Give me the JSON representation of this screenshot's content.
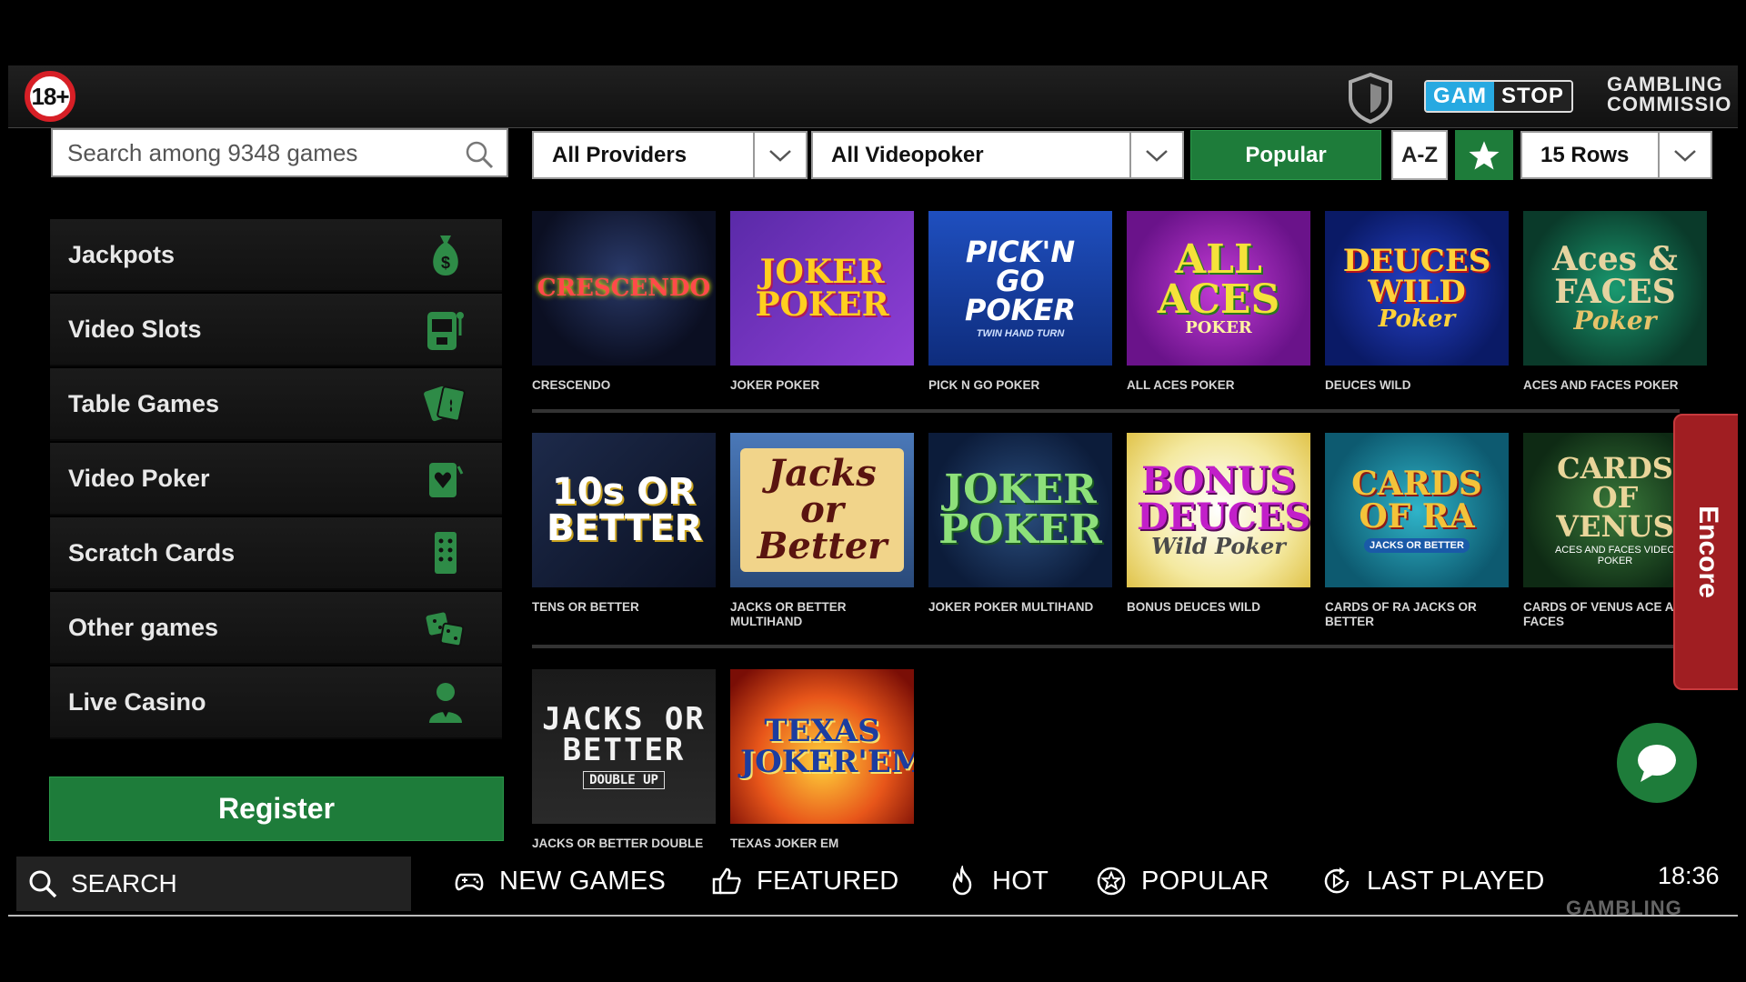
{
  "header": {
    "age_badge": "18+",
    "gamstop_left": "GAM",
    "gamstop_right": "STOP",
    "commission_line1": "GAMBLING",
    "commission_line2": "COMMISSIO",
    "shield_icon": "shield-icon"
  },
  "search": {
    "placeholder": "Search among 9348 games",
    "icon": "search-icon"
  },
  "filters": {
    "providers": "All Providers",
    "category": "All Videopoker",
    "sort_popular": "Popular",
    "sort_az": "A-Z",
    "favorites_icon": "star-icon",
    "rows": "15 Rows"
  },
  "sidebar": {
    "items": [
      {
        "label": "Jackpots",
        "icon": "money-bag-icon"
      },
      {
        "label": "Video Slots",
        "icon": "slot-machine-icon"
      },
      {
        "label": "Table Games",
        "icon": "cards-icon"
      },
      {
        "label": "Video Poker",
        "icon": "poker-card-icon"
      },
      {
        "label": "Scratch Cards",
        "icon": "scratch-card-icon"
      },
      {
        "label": "Other games",
        "icon": "dice-icon"
      },
      {
        "label": "Live Casino",
        "icon": "dealer-icon"
      }
    ],
    "register": "Register"
  },
  "games": [
    {
      "name": "CRESCENDO",
      "art": "CRESCENDO"
    },
    {
      "name": "JOKER POKER",
      "art": "JOKER POKER"
    },
    {
      "name": "PICK N GO POKER",
      "art": "PICK'N GO POKER",
      "art_sub": "TWIN HAND TURN"
    },
    {
      "name": "ALL ACES POKER",
      "art": "ALL ACES",
      "art_sub": "POKER"
    },
    {
      "name": "DEUCES WILD",
      "art": "DEUCES WILD",
      "art_sub": "Poker"
    },
    {
      "name": "ACES AND FACES POKER",
      "art": "Aces & FACES",
      "art_sub": "Poker"
    },
    {
      "name": "TENS OR BETTER",
      "art": "10s OR BETTER"
    },
    {
      "name": "JACKS OR BETTER MULTIHAND",
      "art": "Jacks or Better"
    },
    {
      "name": "JOKER POKER MULTIHAND",
      "art": "JOKER POKER"
    },
    {
      "name": "BONUS DEUCES WILD",
      "art": "BONUS DEUCES",
      "art_sub": "Wild Poker"
    },
    {
      "name": "CARDS OF RA JACKS OR BETTER",
      "art": "CARDS OF RA",
      "art_sub": "JACKS OR BETTER"
    },
    {
      "name": "CARDS OF VENUS ACE A FACES",
      "art": "CARDS OF VENUS",
      "art_sub": "ACES AND FACES VIDEO POKER"
    },
    {
      "name": "JACKS OR BETTER DOUBLE",
      "art": "JACKS OR BETTER",
      "art_sub": "DOUBLE UP"
    },
    {
      "name": "TEXAS JOKER EM",
      "art": "TEXAS JOKER'EM"
    }
  ],
  "encore": "Encore",
  "chat_icon": "chat-bubble-icon",
  "bottom_nav": {
    "search": "SEARCH",
    "new_games": "NEW GAMES",
    "featured": "FEATURED",
    "hot": "HOT",
    "popular": "POPULAR",
    "last_played": "LAST PLAYED",
    "clock": "18:36",
    "footer_ghost": "GAMBLING"
  },
  "colors": {
    "brand_green": "#1e7c3a",
    "encore_red": "#a01e22",
    "gamstop_blue": "#27a9e1"
  }
}
